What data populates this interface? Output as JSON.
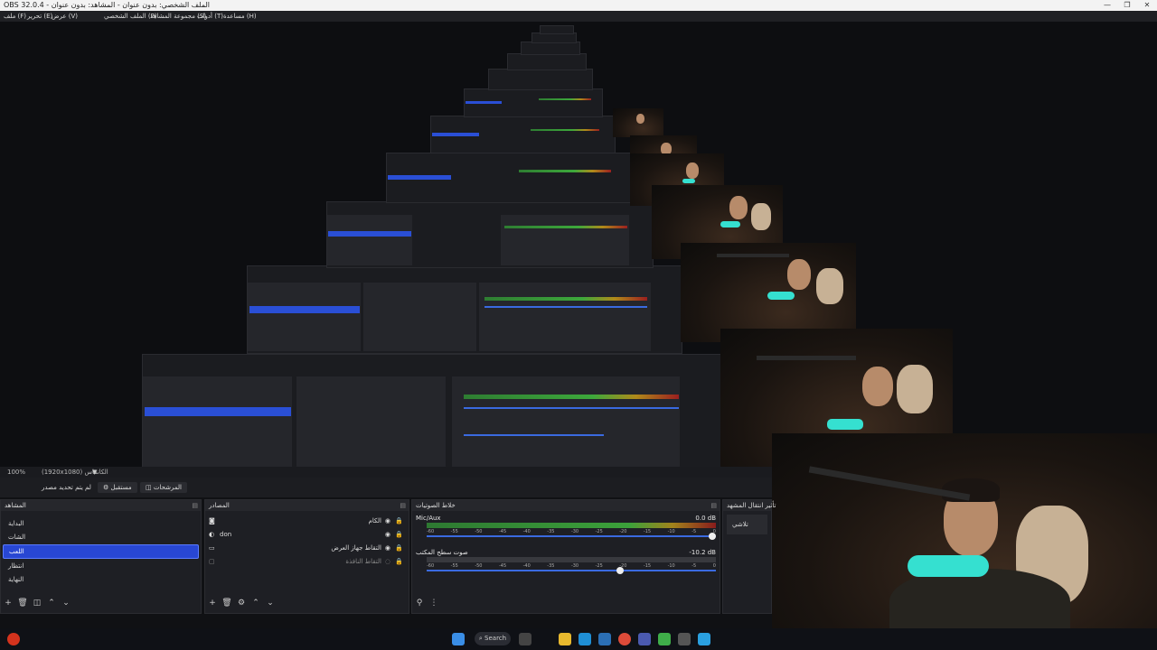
{
  "window": {
    "title": "OBS 32.0.4 - الملف الشخصي: بدون عنوان - المشاهد: بدون عنوان",
    "controls": [
      "—",
      "❐",
      "✕"
    ]
  },
  "menu": [
    "ملف (F)",
    "تحرير (E)",
    "عرض (V)",
    "الملف الشخصي (P)",
    "مجموعة المشاهد (S)",
    "أدوات (T)",
    "مساعدة (H)"
  ],
  "status": {
    "zoom": "100%",
    "canvas": "(1920x1080) الكانفاس"
  },
  "modes": {
    "left": "لم يتم تحديد مصدر",
    "middle": "مستقبل",
    "right": "المرشحات"
  },
  "scenes": {
    "title": "المشاهد",
    "items": [
      "البداية",
      "الشات",
      "اللعب",
      "انتظار",
      "النهاية"
    ],
    "selected_index": 2
  },
  "sources": {
    "title": "المصادر",
    "items": [
      {
        "icon": "camera-icon",
        "name": "الكام"
      },
      {
        "icon": "circle-icon",
        "name": "don"
      },
      {
        "icon": "monitor-icon",
        "name": "التقاط جهاز العرض"
      },
      {
        "icon": "window-icon",
        "name": "التقاط النافذة"
      }
    ]
  },
  "mixer": {
    "title": "خلاط الصوتيات",
    "channels": [
      {
        "name": "Mic/Aux",
        "db": "0.0 dB",
        "level": 0.65,
        "volume": 1.0
      },
      {
        "name": "صوت سطح المكتب",
        "db": "-10.2 dB",
        "level": 0.0,
        "volume": 0.68
      }
    ],
    "ticks": [
      "-60",
      "-55",
      "-50",
      "-45",
      "-40",
      "-35",
      "-30",
      "-25",
      "-20",
      "-15",
      "-10",
      "-5",
      "0"
    ]
  },
  "transitions": {
    "title": "تأثير انتقال المشهد",
    "value": "تلاشي"
  },
  "taskbar": {
    "search": "Search"
  }
}
